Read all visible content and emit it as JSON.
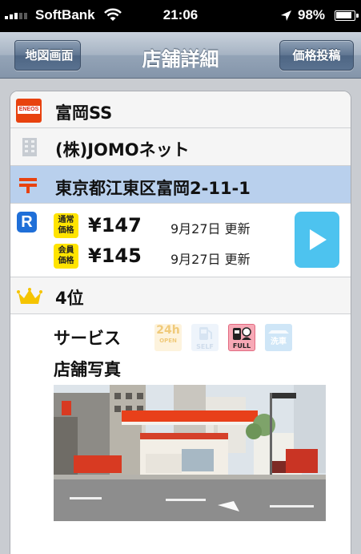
{
  "status_bar": {
    "carrier": "SoftBank",
    "time": "21:06",
    "battery": "98%"
  },
  "nav": {
    "title": "店舗詳細",
    "back_label": "地図画面",
    "post_label": "価格投稿"
  },
  "station": {
    "brand_logo_text": "ENEOS",
    "name": "富岡SS",
    "company": "(株)JOMOネット",
    "address": "東京都江東区富岡2-11-1"
  },
  "prices": [
    {
      "badge_top": "通常",
      "badge_bottom": "価格",
      "value": "¥147",
      "updated": "9月27日 更新"
    },
    {
      "badge_top": "会員",
      "badge_bottom": "価格",
      "value": "¥145",
      "updated": "9月27日 更新"
    }
  ],
  "price_type_icon": "R",
  "rank": "4位",
  "services": {
    "label": "サービス",
    "icons": [
      {
        "name": "24h-open",
        "text_top": "24h",
        "text_bottom": "OPEN",
        "active": false
      },
      {
        "name": "self-service",
        "text": "SELF",
        "active": false
      },
      {
        "name": "full-service",
        "text": "FULL",
        "active": true
      },
      {
        "name": "car-wash",
        "text": "洗車",
        "active": false
      }
    ]
  },
  "photo_section": {
    "label": "店舗写真"
  },
  "colors": {
    "address_highlight": "#b9d0ed",
    "price_badge": "#ffe400",
    "play_button": "#4dc3ef",
    "eneos_red": "#e8420f",
    "post_mark": "#e8420f",
    "crown": "#f5c400"
  }
}
